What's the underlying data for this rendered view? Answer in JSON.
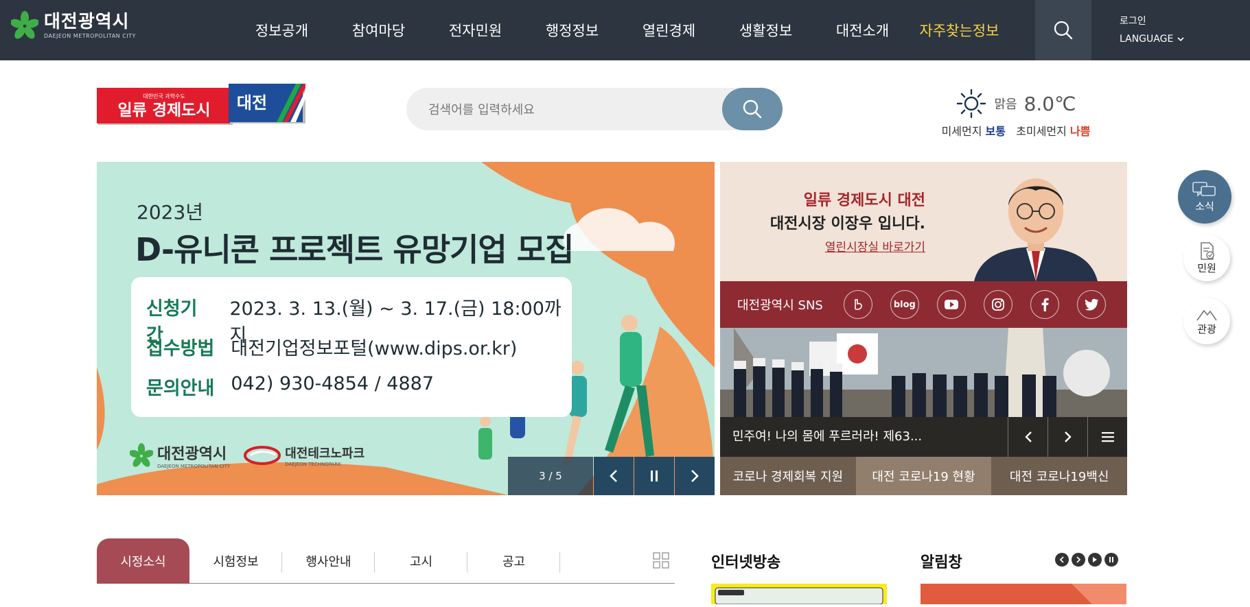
{
  "header": {
    "logo_ko": "대전광역시",
    "logo_en": "DAEJEON METROPOLITAN CITY",
    "nav": [
      "정보공개",
      "참여마당",
      "전자민원",
      "행정정보",
      "열린경제",
      "생활정보",
      "대전소개",
      "자주찾는정보"
    ],
    "login": "로그인",
    "language": "LANGUAGE",
    "colors": {
      "bg": "#2d3540",
      "highlight": "#f5d247"
    }
  },
  "slogan": {
    "small": "대한민국 과학수도",
    "main": "일류 경제도시",
    "city": "대전"
  },
  "search": {
    "placeholder": "검색어를 입력하세요"
  },
  "weather": {
    "condition": "맑음",
    "temperature": "8.0℃",
    "pm10_label": "미세먼지",
    "pm10_value": "보통",
    "pm25_label": "초미세먼지",
    "pm25_value": "나쁨"
  },
  "banner": {
    "year": "2023년",
    "headline": "D-유니콘 프로젝트 유망기업 모집",
    "rows": [
      {
        "key": "신청기간",
        "value": "2023. 3. 13.(월) ~ 3. 17.(금) 18:00까지"
      },
      {
        "key": "접수방법",
        "value": "대전기업정보포털(www.dips.or.kr)"
      },
      {
        "key": "문의안내",
        "value": "042) 930-4854 / 4887"
      }
    ],
    "org1": "대전광역시",
    "org1_en": "DAEJEON METROPOLITAN CITY",
    "org2": "대전테크노파크",
    "org2_en": "DAEJEON TECHNOPARK",
    "counter": "3 / 5"
  },
  "mayor": {
    "line1": "일류 경제도시 대전",
    "line2": "대전시장 이장우 입니다.",
    "link": "열린시장실 바로가기"
  },
  "sns": {
    "label": "대전광역시 SNS",
    "items": [
      "b",
      "blog",
      "youtube",
      "instagram",
      "facebook",
      "twitter"
    ],
    "blog_text": "blog"
  },
  "news": {
    "caption": "민주여! 나의 몸에 푸르러라! 제63..."
  },
  "corona": [
    "코로나 경제회복 지원",
    "대전 코로나19 현황",
    "대전 코로나19백신"
  ],
  "quick_menu": [
    "소식",
    "민원",
    "관광"
  ],
  "tabs": [
    "시정소식",
    "시험정보",
    "행사안내",
    "고시",
    "공고"
  ],
  "sections": {
    "tv": "인터넷방송",
    "notice": "알림창"
  }
}
